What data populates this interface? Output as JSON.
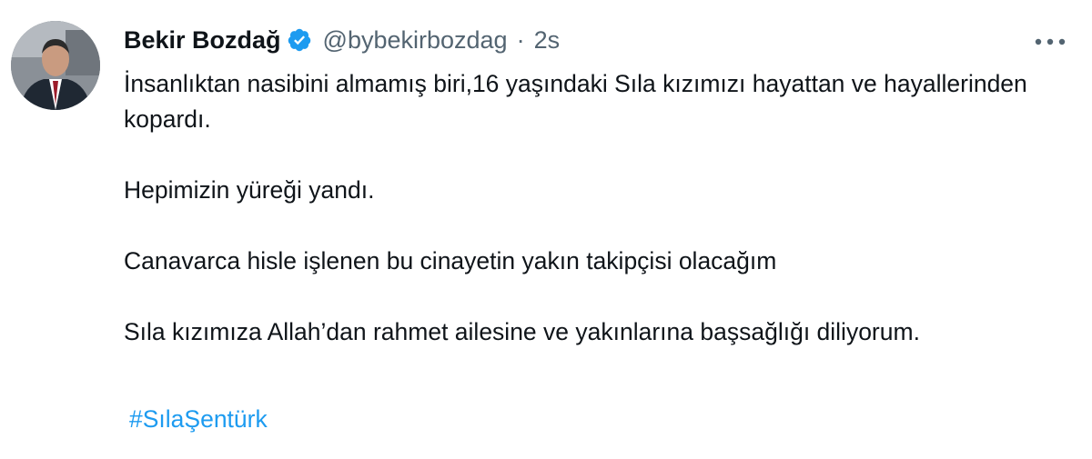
{
  "author": {
    "display_name": "Bekir Bozdağ",
    "handle": "@bybekirbozdag",
    "separator": "·",
    "time": "2s",
    "verified": true
  },
  "tweet": {
    "paragraphs": [
      "İnsanlıktan nasibini almamış biri,16 yaşındaki Sıla kızımızı hayattan ve hayallerinden kopardı.",
      "Hepimizin yüreği yandı.",
      "Canavarca hisle işlenen bu cinayetin yakın takipçisi olacağım",
      "Sıla kızımıza Allah’dan rahmet ailesine ve yakınlarına başsağlığı diliyorum."
    ],
    "hashtag": "#SılaŞentürk"
  },
  "icons": {
    "verified": "verified-badge-icon",
    "more": "more-options-icon"
  },
  "colors": {
    "text": "#0f1419",
    "secondary": "#536471",
    "accent": "#1d9bf0"
  }
}
